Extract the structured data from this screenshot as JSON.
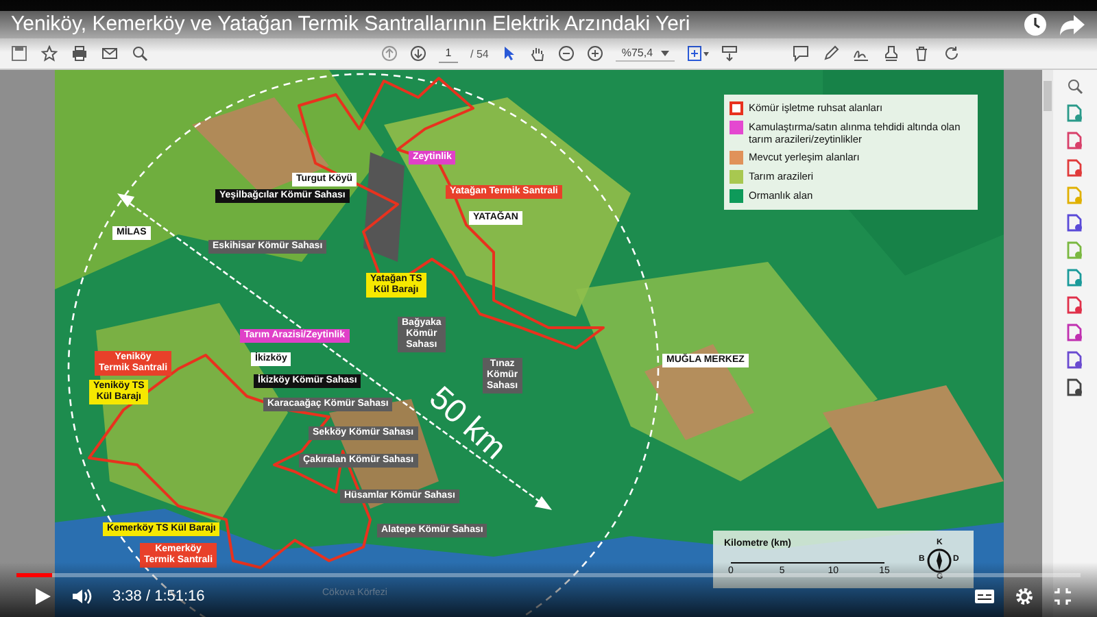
{
  "video": {
    "title": "Yeniköy, Kemerköy ve Yatağan Termik Santrallarının Elektrik Arzındaki Yeri",
    "time": "3:38 / 1:51:16",
    "progress": {
      "level": 0.034
    }
  },
  "toolbar": {
    "page": "1",
    "page_count": "/ 54",
    "zoom": "%75,4"
  },
  "map": {
    "labels": [
      {
        "lines": [
          "Zeytinlik"
        ],
        "kind": "magenta"
      },
      {
        "lines": [
          "Turgut Köyü"
        ],
        "kind": "white"
      },
      {
        "lines": [
          "Yeşilbağcılar Kömür Sahası"
        ],
        "kind": "black"
      },
      {
        "lines": [
          "Yatağan Termik Santrali"
        ],
        "kind": "red"
      },
      {
        "lines": [
          "YATAĞAN"
        ],
        "kind": "white"
      },
      {
        "lines": [
          "MİLAS"
        ],
        "kind": "white"
      },
      {
        "lines": [
          "Eskihisar Kömür Sahası"
        ],
        "kind": "gray"
      },
      {
        "lines": [
          "Yatağan TS",
          "Kül Barajı"
        ],
        "kind": "yellow"
      },
      {
        "lines": [
          "Tarım Arazisi/Zeytinlik"
        ],
        "kind": "magenta"
      },
      {
        "lines": [
          "Bağyaka",
          "Kömür",
          "Sahası"
        ],
        "kind": "gray"
      },
      {
        "lines": [
          "Yeniköy",
          "Termik Santrali"
        ],
        "kind": "red"
      },
      {
        "lines": [
          "İkizköy"
        ],
        "kind": "white"
      },
      {
        "lines": [
          "Tınaz",
          "Kömür",
          "Sahası"
        ],
        "kind": "gray"
      },
      {
        "lines": [
          "MUĞLA MERKEZ"
        ],
        "kind": "white"
      },
      {
        "lines": [
          "Yeniköy TS",
          "Kül Barajı"
        ],
        "kind": "yellow"
      },
      {
        "lines": [
          "İkizköy Kömür Sahası"
        ],
        "kind": "black"
      },
      {
        "lines": [
          "Karacaağaç Kömür Sahası"
        ],
        "kind": "gray"
      },
      {
        "lines": [
          "Sekköy Kömür Sahası"
        ],
        "kind": "gray"
      },
      {
        "lines": [
          "Çakıralan Kömür Sahası"
        ],
        "kind": "gray"
      },
      {
        "lines": [
          "Hüsamlar Kömür Sahası"
        ],
        "kind": "gray"
      },
      {
        "lines": [
          "Kemerköy TS Kül Barajı"
        ],
        "kind": "yellow"
      },
      {
        "lines": [
          "Alatepe Kömür Sahası"
        ],
        "kind": "gray"
      },
      {
        "lines": [
          "Kemerköy",
          "Termik Santrali"
        ],
        "kind": "red"
      },
      {
        "lines": [
          "Cökova Körfezi"
        ],
        "kind": "water"
      }
    ],
    "distance_label": "50 km",
    "legend": [
      {
        "label": "Kömür işletme ruhsat alanları",
        "kind": "outline",
        "color": "#e8321e"
      },
      {
        "label": "Kamulaştırma/satın alınma tehdidi altında olan tarım arazileri/zeytinlikler",
        "kind": "fill",
        "color": "#e448d0"
      },
      {
        "label": "Mevcut yerleşim alanları",
        "kind": "fill",
        "color": "#e0925a"
      },
      {
        "label": "Tarım arazileri",
        "kind": "fill",
        "color": "#a8c850"
      },
      {
        "label": "Ormanlık alan",
        "kind": "fill",
        "color": "#0e9a5a"
      }
    ],
    "scale": {
      "title": "Kilometre (km)",
      "ticks": [
        "0",
        "5",
        "10",
        "15"
      ]
    },
    "compass": [
      "K",
      "B",
      "D",
      "G"
    ]
  }
}
